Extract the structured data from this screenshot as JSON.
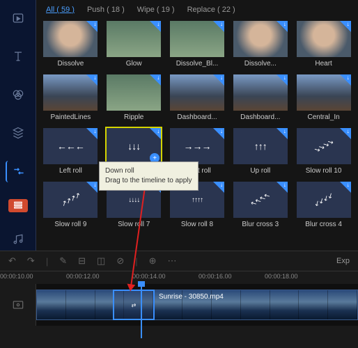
{
  "tabs": [
    {
      "label": "All ( 59 )",
      "active": true
    },
    {
      "label": "Push ( 18 )",
      "active": false
    },
    {
      "label": "Wipe ( 19 )",
      "active": false
    },
    {
      "label": "Replace ( 22 )",
      "active": false
    }
  ],
  "transitions": [
    {
      "name": "Dissolve",
      "type": "face"
    },
    {
      "name": "Glow",
      "type": "dog"
    },
    {
      "name": "Dissolve_Bl...",
      "type": "dog"
    },
    {
      "name": "Dissolve...",
      "type": "face"
    },
    {
      "name": "Heart",
      "type": "face"
    },
    {
      "name": "PaintedLines",
      "type": "road"
    },
    {
      "name": "Ripple",
      "type": "dog"
    },
    {
      "name": "Dashboard...",
      "type": "road"
    },
    {
      "name": "Dashboard...",
      "type": "road"
    },
    {
      "name": "Central_In",
      "type": "road"
    },
    {
      "name": "Left roll",
      "type": "arrow",
      "glyph": "←←←"
    },
    {
      "name": "Down roll",
      "type": "arrow",
      "glyph": "↓↓↓",
      "selected": true,
      "add": true
    },
    {
      "name": "Right roll",
      "type": "arrow",
      "glyph": "→→→"
    },
    {
      "name": "Up roll",
      "type": "arrow",
      "glyph": "↑↑↑"
    },
    {
      "name": "Slow roll 10",
      "type": "arrow",
      "glyph": "↘↘↘↘",
      "small": true,
      "diag": true
    },
    {
      "name": "Slow roll 9",
      "type": "arrow",
      "glyph": "↗↗↗↗",
      "small": true,
      "diag": true
    },
    {
      "name": "Slow roll 7",
      "type": "arrow",
      "glyph": "↓↓↓↓",
      "small": true
    },
    {
      "name": "Slow roll 8",
      "type": "arrow",
      "glyph": "↑↑↑↑",
      "small": true
    },
    {
      "name": "Blur cross 3",
      "type": "arrow",
      "glyph": "↖↖↖↖",
      "small": true,
      "diag": true
    },
    {
      "name": "Blur cross 4",
      "type": "arrow",
      "glyph": "↙↙↙↙",
      "small": true,
      "diag": true
    }
  ],
  "tooltip": {
    "title": "Down roll",
    "hint": "Drag to the timeline to apply"
  },
  "timeline": {
    "export": "Exp",
    "ticks": [
      "00:00:10.00",
      "00:00:12.00",
      "00:00:14.00",
      "00:00:16.00",
      "00:00:18.00"
    ],
    "clip_name": "Sunrise - 30850.mp4"
  },
  "toolbar": [
    "media",
    "text",
    "filter",
    "overlay",
    "transition",
    "element",
    "audio"
  ]
}
